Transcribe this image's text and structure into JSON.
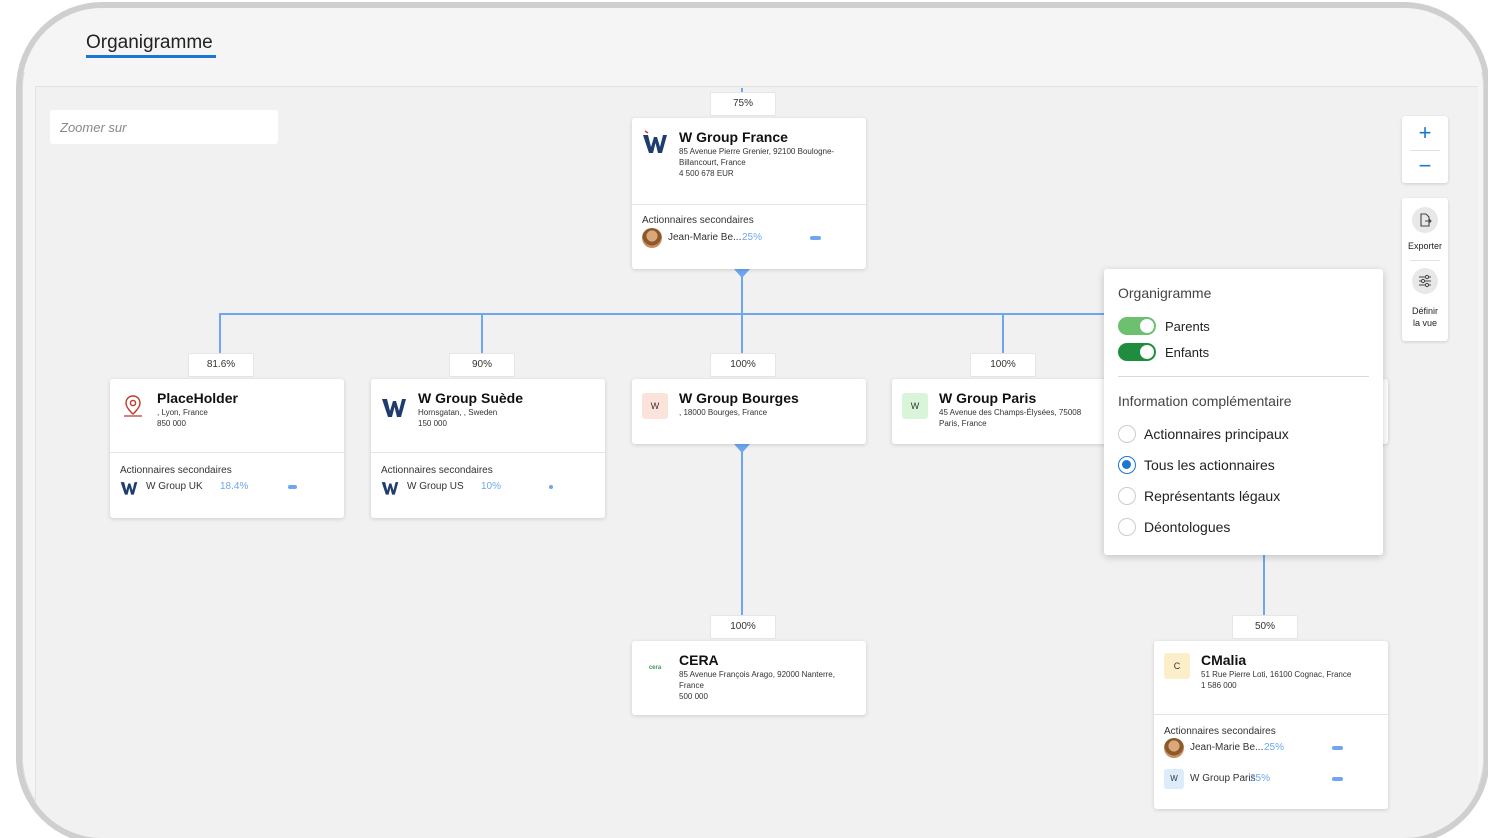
{
  "header": {
    "title": "Organigramme"
  },
  "zoom": {
    "placeholder": "Zoomer sur"
  },
  "labels": {
    "secondary_shareholders": "Actionnaires secondaires"
  },
  "controls": {
    "zoom_in": "+",
    "zoom_out": "−",
    "export_label": "Exporter",
    "define_view_label_1": "Définir",
    "define_view_label_2": "la vue"
  },
  "percentages": {
    "top": "75%",
    "placeholder": "81.6%",
    "suede": "90%",
    "bourges": "100%",
    "paris": "100%",
    "cera": "100%",
    "cmalia": "50%"
  },
  "nodes": {
    "france": {
      "name": "W Group France",
      "addr1": "85 Avenue Pierre Grenier, 92100 Boulogne-",
      "addr2": "Billancourt, France",
      "capital": "4 500 678 EUR",
      "sh1_name": "Jean-Marie Be...",
      "sh1_pct": "25%"
    },
    "placeholder": {
      "name": "PlaceHolder",
      "addr1": ", Lyon, France",
      "capital": "850 000",
      "sh1_name": "W Group UK",
      "sh1_pct": "18.4%"
    },
    "suede": {
      "name": "W Group Suède",
      "addr1": "Hornsgatan, , Sweden",
      "capital": "150 000",
      "sh1_name": "W Group US",
      "sh1_pct": "10%"
    },
    "bourges": {
      "name": "W Group Bourges",
      "addr1": ", 18000 Bourges, France",
      "badge": "W"
    },
    "paris": {
      "name": "W Group Paris",
      "addr1": "45 Avenue des Champs-Élysées, 75008",
      "addr2": "Paris, France",
      "badge": "W"
    },
    "cera": {
      "name": "CERA",
      "addr1": "85 Avenue François Arago, 92000 Nanterre,",
      "addr2": "France",
      "capital": "500 000",
      "logo_text": "cera"
    },
    "cmalia": {
      "name": "CMalia",
      "addr1": "51 Rue Pierre Loti, 16100 Cognac, France",
      "capital": "1 586 000",
      "badge": "C",
      "sh1_name": "Jean-Marie Be...",
      "sh1_pct": "25%",
      "sh2_badge": "W",
      "sh2_name": "W Group Paris",
      "sh2_pct": "25%"
    }
  },
  "panel": {
    "title": "Organigramme",
    "toggle_parents": "Parents",
    "toggle_parents_on": true,
    "toggle_children": "Enfants",
    "toggle_children_on": true,
    "section2": "Information complémentaire",
    "options": [
      "Actionnaires principaux",
      "Tous les actionnaires",
      "Représentants légaux",
      "Déontologues"
    ],
    "selected_option": "Tous les actionnaires"
  },
  "colors": {
    "accent": "#1976d2",
    "connector": "#6ea6ef",
    "toggle_parents": "#6cc070",
    "toggle_children": "#1e8e3e",
    "badge_bourges": "#fbe3dc",
    "badge_paris": "#d9f5d9",
    "badge_cmalia": "#fbeec8",
    "badge_wparis": "#dcecfb"
  }
}
